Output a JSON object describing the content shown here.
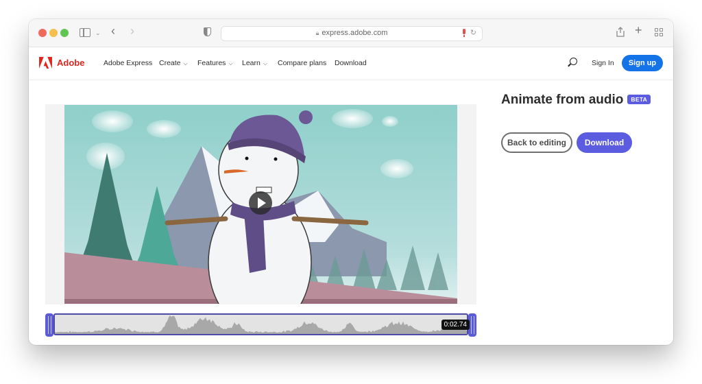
{
  "browser": {
    "url": "express.adobe.com",
    "icons": {
      "sidebar": "sidebar-icon",
      "back": "chevron-left-icon",
      "forward": "chevron-right-icon",
      "privacy": "shield-icon",
      "lock": "lock-icon",
      "mic": "microphone-icon",
      "reload": "reload-icon",
      "share": "share-icon",
      "new_tab": "plus-icon",
      "tab_overview": "grid-icon"
    }
  },
  "nav": {
    "brand": "Adobe",
    "items": [
      {
        "label": "Adobe Express",
        "has_dropdown": false
      },
      {
        "label": "Create",
        "has_dropdown": true
      },
      {
        "label": "Features",
        "has_dropdown": true
      },
      {
        "label": "Learn",
        "has_dropdown": true
      },
      {
        "label": "Compare plans",
        "has_dropdown": false
      },
      {
        "label": "Download",
        "has_dropdown": false
      }
    ],
    "chevron": "⌄",
    "sign_in": "Sign In",
    "sign_up": "Sign up",
    "accent": "#1473e6",
    "brand_color": "#e1251b"
  },
  "panel": {
    "title": "Animate from audio",
    "badge": "BETA",
    "back_button": "Back to editing",
    "download_button": "Download",
    "accent": "#5c5ce0"
  },
  "player": {
    "state": "paused",
    "scene": "Animated snowman with purple hat and scarf in a snowy mountain landscape",
    "timeline": {
      "duration_label": "0:02.74"
    }
  }
}
